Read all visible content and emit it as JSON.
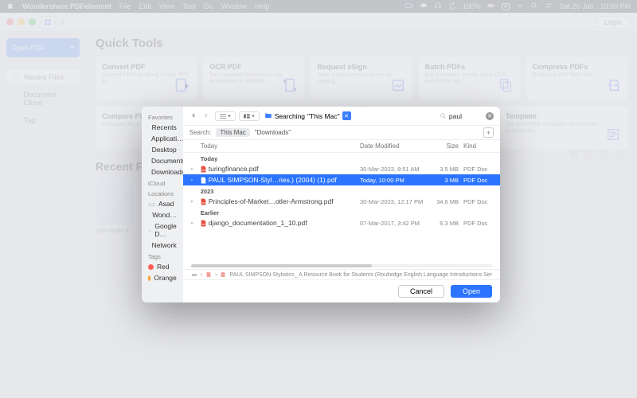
{
  "menubar": {
    "app": "Wondershare PDFelement",
    "items": [
      "File",
      "Edit",
      "View",
      "Tool",
      "Go",
      "Window",
      "Help"
    ],
    "battery": "100%",
    "date": "Sat 20 Jan",
    "time": "10:09 PM"
  },
  "toolbar": {
    "login": "Login"
  },
  "sidebar_app": {
    "open_pdf": "Open PDF",
    "items": [
      {
        "label": "Recent Files",
        "active": true
      },
      {
        "label": "Document Cloud",
        "active": false
      },
      {
        "label": "Tag",
        "active": false
      }
    ]
  },
  "quick_tools": {
    "title": "Quick Tools",
    "row1": [
      {
        "title": "Convert PDF",
        "desc": "Convert PDFs to Word, Excel, PPT, etc."
      },
      {
        "title": "OCR PDF",
        "desc": "Turn scanned documents into searchable or editable."
      },
      {
        "title": "Request eSign",
        "desc": "Send a document to others for signing."
      },
      {
        "title": "Batch PDFs",
        "desc": "Batch convert, create, print, OCR and PDFs, etc."
      },
      {
        "title": "Compress PDFs",
        "desc": "Reduce a PDF file's size."
      }
    ],
    "row2": [
      {
        "title": "Compare PDFs",
        "desc": "Compare the similarities between two."
      },
      {
        "title": "",
        "desc": ""
      },
      {
        "title": "",
        "desc": ""
      },
      {
        "title": "Template",
        "desc": "Get great PDF templates for resumes, posters, etc."
      }
    ]
  },
  "recent_files": {
    "title": "Recent Files",
    "thumb_label": "User Guide B"
  },
  "dialog": {
    "sidebar": {
      "favorites_hdr": "Favorites",
      "favorites": [
        "Recents",
        "Applicati…",
        "Desktop",
        "Documents",
        "Downloads"
      ],
      "icloud_hdr": "iCloud",
      "locations_hdr": "Locations",
      "locations": [
        "Asad",
        "Wond…",
        "Google D…",
        "Network"
      ],
      "tags_hdr": "Tags",
      "tags": [
        {
          "label": "Red",
          "color": "#ff5f57"
        },
        {
          "label": "Orange",
          "color": "#ff9f2e"
        }
      ]
    },
    "crumb_prefix": "Searching",
    "crumb_scope": "\"This Mac\"",
    "search_value": "paul",
    "scope": {
      "label": "Search:",
      "this_mac": "This Mac",
      "downloads": "\"Downloads\""
    },
    "columns": {
      "name": "Today",
      "date": "Date Modified",
      "size": "Size",
      "kind": "Kind"
    },
    "groups": [
      {
        "label": "Today",
        "rows": [
          {
            "name": "turingfinance.pdf",
            "date": "30-Mar-2023, 8:51 AM",
            "size": "3.5 MB",
            "kind": "PDF Doc",
            "sel": false
          },
          {
            "name": "PAUL SIMPSON-Styl…ries.) (2004) (1).pdf",
            "date": "Today, 10:00 PM",
            "size": "3 MB",
            "kind": "PDF Doc",
            "sel": true
          }
        ]
      },
      {
        "label": "2023",
        "rows": [
          {
            "name": "Principles-of-Market…otler-Armstrong.pdf",
            "date": "30-Mar-2023, 12:17 PM",
            "size": "34.6 MB",
            "kind": "PDF Doc",
            "sel": false
          }
        ]
      },
      {
        "label": "Earlier",
        "rows": [
          {
            "name": "django_documentation_1_10.pdf",
            "date": "07-Mar-2017, 3:42 PM",
            "size": "6.3 MB",
            "kind": "PDF Doc",
            "sel": false
          }
        ]
      }
    ],
    "path": "PAUL SIMPSON-Stylistics_ A Resource Book for Students (Routledge English Language Introductions Ser",
    "cancel": "Cancel",
    "open": "Open"
  }
}
